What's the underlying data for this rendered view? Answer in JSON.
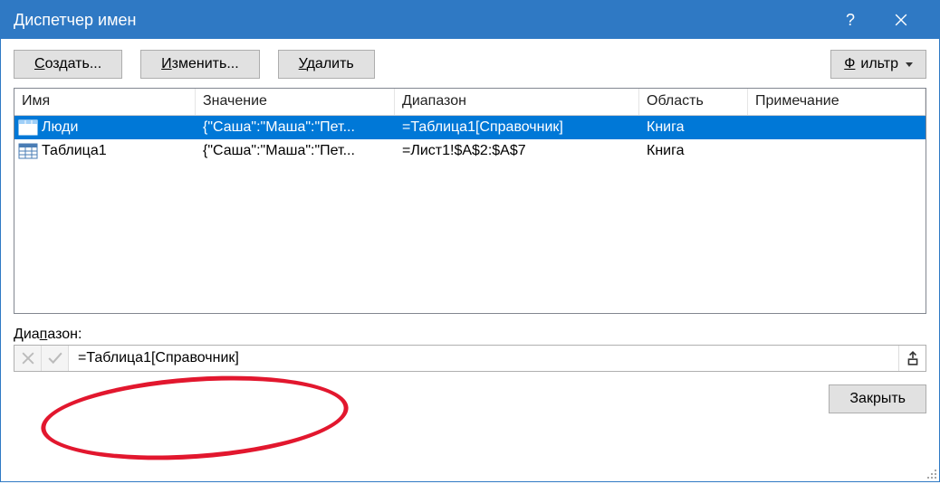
{
  "window": {
    "title": "Диспетчер имен"
  },
  "toolbar": {
    "create": "Создать...",
    "create_u": "С",
    "edit": "Изменить...",
    "edit_u": "И",
    "delete": "Удалить",
    "delete_u": "У",
    "filter": "Фильтр",
    "filter_u": "Ф"
  },
  "columns": [
    "Имя",
    "Значение",
    "Диапазон",
    "Область",
    "Примечание"
  ],
  "rows": [
    {
      "name": "Люди",
      "value": "{\"Саша\":\"Маша\":\"Пет...",
      "range": "=Таблица1[Справочник]",
      "scope": "Книга",
      "comment": "",
      "selected": true
    },
    {
      "name": "Таблица1",
      "value": "{\"Саша\":\"Маша\":\"Пет...",
      "range": "=Лист1!$A$2:$A$7",
      "scope": "Книга",
      "comment": "",
      "selected": false
    }
  ],
  "range": {
    "label": "Диапазон:",
    "label_u": "п",
    "value": "=Таблица1[Справочник]"
  },
  "footer": {
    "close": "Закрыть"
  }
}
